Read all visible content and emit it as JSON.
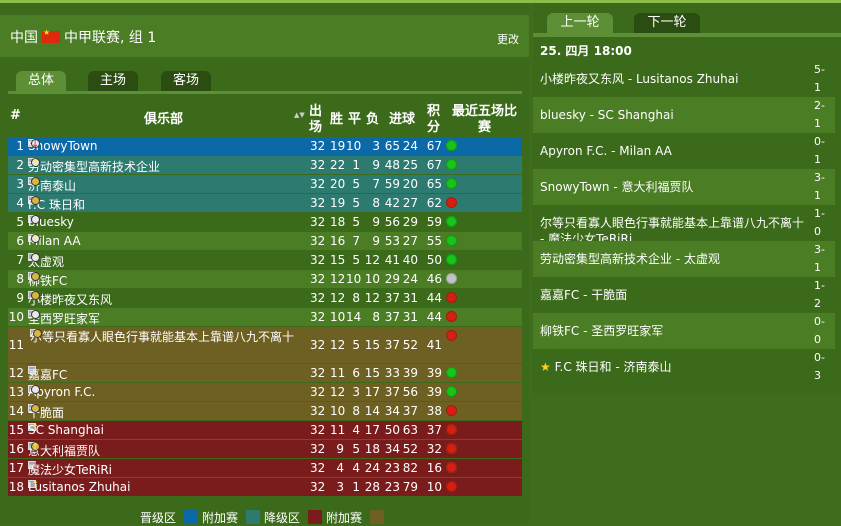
{
  "header": {
    "country": "中国",
    "league": "中甲联赛, 组 1",
    "change_label": "更改"
  },
  "tabs": [
    {
      "label": "总体",
      "active": true
    },
    {
      "label": "主场",
      "active": false
    },
    {
      "label": "客场",
      "active": false
    }
  ],
  "table": {
    "columns": {
      "rank": "#",
      "club": "俱乐部",
      "played_a": "出",
      "played_b": "场",
      "win": "胜",
      "draw": "平",
      "loss": "负",
      "goals": "进球",
      "points_a": "积",
      "points_b": "分",
      "form_a": "最近五场比",
      "form_b": "赛"
    },
    "rows": [
      {
        "rank": "1",
        "club": "SnowyTown",
        "p": "32",
        "w": "19",
        "d": "10",
        "l": "3",
        "gf": "65",
        "ga": "24",
        "pts": "67",
        "zone": "promo",
        "badge": "white",
        "trend": "down",
        "form": [
          "n",
          "n",
          "g",
          "g",
          "g"
        ]
      },
      {
        "rank": "2",
        "club": "劳动密集型高新技术企业",
        "p": "32",
        "w": "22",
        "d": "1",
        "l": "9",
        "gf": "48",
        "ga": "25",
        "pts": "67",
        "zone": "promo2",
        "badge": "white",
        "trend": "up",
        "form": [
          "g",
          "r",
          "g",
          "g",
          "g"
        ]
      },
      {
        "rank": "3",
        "club": "济南泰山",
        "p": "32",
        "w": "20",
        "d": "5",
        "l": "7",
        "gf": "59",
        "ga": "20",
        "pts": "65",
        "zone": "promo2",
        "badge": "gold",
        "trend": "",
        "form": [
          "g",
          "g",
          "g",
          "g",
          "g"
        ]
      },
      {
        "rank": "4",
        "club": "F.C 珠日和",
        "p": "32",
        "w": "19",
        "d": "5",
        "l": "8",
        "gf": "42",
        "ga": "27",
        "pts": "62",
        "zone": "promo2",
        "badge": "gold",
        "trend": "",
        "form": [
          "g",
          "r",
          "n",
          "g",
          "r"
        ]
      },
      {
        "rank": "5",
        "club": "bluesky",
        "p": "32",
        "w": "18",
        "d": "5",
        "l": "9",
        "gf": "56",
        "ga": "29",
        "pts": "59",
        "zone": "none",
        "badge": "white",
        "trend": "",
        "form": [
          "g",
          "g",
          "g",
          "g",
          "g"
        ]
      },
      {
        "rank": "6",
        "club": "Milan AA",
        "p": "32",
        "w": "16",
        "d": "7",
        "l": "9",
        "gf": "53",
        "ga": "27",
        "pts": "55",
        "zone": "none",
        "badge": "white",
        "trend": "up",
        "form": [
          "r",
          "g",
          "r",
          "g",
          "g"
        ]
      },
      {
        "rank": "7",
        "club": "太虚观",
        "p": "32",
        "w": "15",
        "d": "5",
        "l": "12",
        "gf": "41",
        "ga": "40",
        "pts": "50",
        "zone": "none",
        "badge": "white",
        "trend": "",
        "form": [
          "g",
          "g",
          "g",
          "g",
          "g"
        ]
      },
      {
        "rank": "8",
        "club": "柳铁FC",
        "p": "32",
        "w": "12",
        "d": "10",
        "l": "10",
        "gf": "29",
        "ga": "24",
        "pts": "46",
        "zone": "none",
        "badge": "gold",
        "trend": "",
        "form": [
          "g",
          "n",
          "g",
          "n",
          "n"
        ]
      },
      {
        "rank": "9",
        "club": "小楼昨夜又东风",
        "p": "32",
        "w": "12",
        "d": "8",
        "l": "12",
        "gf": "37",
        "ga": "31",
        "pts": "44",
        "zone": "none",
        "badge": "gold",
        "trend": "",
        "form": [
          "r",
          "r",
          "g",
          "g",
          "r"
        ]
      },
      {
        "rank": "10",
        "club": "圣西罗旺家军",
        "p": "32",
        "w": "10",
        "d": "14",
        "l": "8",
        "gf": "37",
        "ga": "31",
        "pts": "44",
        "zone": "none",
        "badge": "white",
        "trend": "",
        "form": [
          "g",
          "g",
          "g",
          "g",
          "r"
        ]
      },
      {
        "rank": "11",
        "club": "尔等只看寡人眼色行事就能基本上靠谱八九不离十",
        "p": "32",
        "w": "12",
        "d": "5",
        "l": "15",
        "gf": "37",
        "ga": "52",
        "pts": "41",
        "zone": "rel2",
        "badge": "gold",
        "trend": "",
        "form": [
          "g",
          "r",
          "g",
          "g",
          "r"
        ]
      },
      {
        "rank": "12",
        "club": "嘉嘉FC",
        "p": "32",
        "w": "11",
        "d": "6",
        "l": "15",
        "gf": "33",
        "ga": "39",
        "pts": "39",
        "zone": "rel2",
        "badge": "",
        "trend": "",
        "form": [
          "r",
          "r",
          "g",
          "g",
          "g"
        ]
      },
      {
        "rank": "13",
        "club": "Apyron F.C.",
        "p": "32",
        "w": "12",
        "d": "3",
        "l": "17",
        "gf": "37",
        "ga": "56",
        "pts": "39",
        "zone": "rel2",
        "badge": "white",
        "trend": "",
        "form": [
          "r",
          "g",
          "r",
          "r",
          "g"
        ]
      },
      {
        "rank": "14",
        "club": "干脆面",
        "p": "32",
        "w": "10",
        "d": "8",
        "l": "14",
        "gf": "34",
        "ga": "37",
        "pts": "38",
        "zone": "rel2",
        "badge": "gold",
        "trend": "",
        "form": [
          "g",
          "g",
          "g",
          "g",
          "r"
        ]
      },
      {
        "rank": "15",
        "club": "SC Shanghai",
        "p": "32",
        "w": "11",
        "d": "4",
        "l": "17",
        "gf": "50",
        "ga": "63",
        "pts": "37",
        "zone": "rel",
        "badge": "",
        "trend": "up",
        "form": [
          "r",
          "r",
          "r",
          "g",
          "r"
        ]
      },
      {
        "rank": "16",
        "club": "意大利福贾队",
        "p": "32",
        "w": "9",
        "d": "5",
        "l": "18",
        "gf": "34",
        "ga": "52",
        "pts": "32",
        "zone": "rel",
        "badge": "gold",
        "trend": "up",
        "form": [
          "n",
          "r",
          "r",
          "g",
          "r"
        ]
      },
      {
        "rank": "17",
        "club": "魔法少女TeRiRi",
        "p": "32",
        "w": "4",
        "d": "4",
        "l": "24",
        "gf": "23",
        "ga": "82",
        "pts": "16",
        "zone": "rel",
        "badge": "",
        "trend": "down",
        "form": [
          "r",
          "r",
          "n",
          "g",
          "r"
        ]
      },
      {
        "rank": "18",
        "club": "Lusitanos Zhuhai",
        "p": "32",
        "w": "3",
        "d": "1",
        "l": "28",
        "gf": "23",
        "ga": "79",
        "pts": "10",
        "zone": "rel",
        "badge": "",
        "trend": "up",
        "form": [
          "r",
          "r",
          "r",
          "r",
          "r"
        ]
      }
    ]
  },
  "legend": [
    {
      "label": "晋级区",
      "color": "#0b69a8"
    },
    {
      "label": "附加赛",
      "color": "#2d7a70"
    },
    {
      "label": "降级区",
      "color": "#7b1c1c"
    },
    {
      "label": "附加赛",
      "color": "#6e6022"
    }
  ],
  "rounds": {
    "prev_label": "上一轮",
    "next_label": "下一轮",
    "date": "25. 四月 18:00",
    "matches": [
      {
        "name": "小楼昨夜又东风 - Lusitanos Zhuhai",
        "s1": "5-",
        "s2": "1",
        "star": false
      },
      {
        "name": "bluesky - SC Shanghai",
        "s1": "2-",
        "s2": "1",
        "star": false
      },
      {
        "name": "Apyron F.C. - Milan AA",
        "s1": "0-",
        "s2": "1",
        "star": false
      },
      {
        "name": "SnowyTown - 意大利福贾队",
        "s1": "3-",
        "s2": "1",
        "star": false
      },
      {
        "name": "尔等只看寡人眼色行事就能基本上靠谱八九不离十 - 魔法少女TeRiRi",
        "s1": "1-",
        "s2": "0",
        "star": false
      },
      {
        "name": "劳动密集型高新技术企业 - 太虚观",
        "s1": "3-",
        "s2": "1",
        "star": false
      },
      {
        "name": "嘉嘉FC - 干脆面",
        "s1": "1-",
        "s2": "2",
        "star": false
      },
      {
        "name": "柳铁FC - 圣西罗旺家军",
        "s1": "0-",
        "s2": "0",
        "star": false
      },
      {
        "name": "F.C 珠日和 - 济南泰山",
        "s1": "0-",
        "s2": "3",
        "star": true
      }
    ]
  },
  "colors": {
    "promo": "#0b69a8",
    "promo2": "#2d7a70",
    "rel": "#7b1c1c",
    "rel2": "#6e6022",
    "row_a": "#3c6a1b",
    "row_b": "#4a7d24"
  }
}
